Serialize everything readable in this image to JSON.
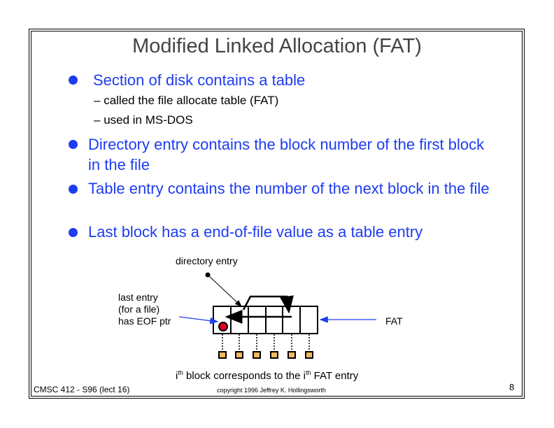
{
  "title": "Modified Linked Allocation (FAT)",
  "bullets": [
    {
      "text": "Section of disk contains a table",
      "subitems": [
        "called the file allocate table (FAT)",
        "used in MS-DOS"
      ]
    },
    {
      "text": "Directory entry contains the block number of the first block in the file"
    },
    {
      "text": "Table entry contains the number of the next block in the file"
    },
    {
      "text": "Last block has a end-of-file value as a table entry"
    }
  ],
  "diagram": {
    "directory_label": "directory entry",
    "last_entry_label": [
      "last entry",
      "(for a file)",
      "has EOF ptr"
    ],
    "fat_label": "FAT",
    "caption": {
      "i1": "i",
      "th1": "th",
      "mid": " block corresponds to the i",
      "th2": "th",
      "end": " FAT entry"
    },
    "colors": {
      "arrow": "#1e3cf0",
      "eof": "#e00020",
      "block": "#f4b860"
    }
  },
  "footer": {
    "course": "CMSC 412 - S96  (lect 16)",
    "copyright": "copyright 1996  Jeffrey K. Hollingsworth",
    "page": "8"
  }
}
